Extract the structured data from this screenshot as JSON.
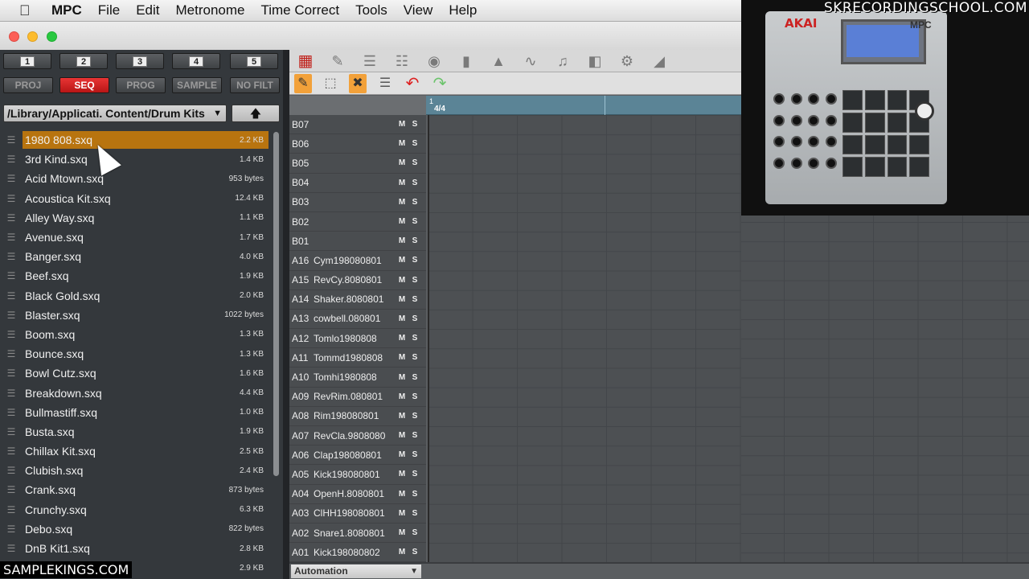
{
  "menubar": {
    "apple": "",
    "app": "MPC",
    "items": [
      "File",
      "Edit",
      "Metronome",
      "Time Correct",
      "Tools",
      "View",
      "Help"
    ]
  },
  "browser": {
    "num_buttons": [
      "1",
      "2",
      "3",
      "4",
      "5"
    ],
    "mode_buttons": [
      "PROJ",
      "SEQ",
      "PROG",
      "SAMPLE",
      "NO FILT"
    ],
    "active_mode": "SEQ",
    "path": "/Library/Applicati. Content/Drum Kits",
    "up_icon": "up-arrow-icon",
    "files": [
      {
        "name": "1980 808.sxq",
        "size": "2.2 KB",
        "selected": true
      },
      {
        "name": "3rd Kind.sxq",
        "size": "1.4 KB"
      },
      {
        "name": "Acid Mtown.sxq",
        "size": "953 bytes"
      },
      {
        "name": "Acoustica Kit.sxq",
        "size": "12.4 KB"
      },
      {
        "name": "Alley Way.sxq",
        "size": "1.1 KB"
      },
      {
        "name": "Avenue.sxq",
        "size": "1.7 KB"
      },
      {
        "name": "Banger.sxq",
        "size": "4.0 KB"
      },
      {
        "name": "Beef.sxq",
        "size": "1.9 KB"
      },
      {
        "name": "Black Gold.sxq",
        "size": "2.0 KB"
      },
      {
        "name": "Blaster.sxq",
        "size": "1022 bytes"
      },
      {
        "name": "Boom.sxq",
        "size": "1.3 KB"
      },
      {
        "name": "Bounce.sxq",
        "size": "1.3 KB"
      },
      {
        "name": "Bowl Cutz.sxq",
        "size": "1.6 KB"
      },
      {
        "name": "Breakdown.sxq",
        "size": "4.4 KB"
      },
      {
        "name": "Bullmastiff.sxq",
        "size": "1.0 KB"
      },
      {
        "name": "Busta.sxq",
        "size": "1.9 KB"
      },
      {
        "name": "Chillax Kit.sxq",
        "size": "2.5 KB"
      },
      {
        "name": "Clubish.sxq",
        "size": "2.4 KB"
      },
      {
        "name": "Crank.sxq",
        "size": "873 bytes"
      },
      {
        "name": "Crunchy.sxq",
        "size": "6.3 KB"
      },
      {
        "name": "Debo.sxq",
        "size": "822 bytes"
      },
      {
        "name": "DnB Kit1.sxq",
        "size": "2.8 KB"
      },
      {
        "name": "",
        "size": "2.9 KB"
      }
    ]
  },
  "sequencer": {
    "timeline": {
      "bar": "1",
      "time_signature": "4/4"
    },
    "tracks": [
      {
        "id": "B07",
        "name": ""
      },
      {
        "id": "B06",
        "name": ""
      },
      {
        "id": "B05",
        "name": ""
      },
      {
        "id": "B04",
        "name": ""
      },
      {
        "id": "B03",
        "name": ""
      },
      {
        "id": "B02",
        "name": ""
      },
      {
        "id": "B01",
        "name": ""
      },
      {
        "id": "A16",
        "name": "Cym198080801"
      },
      {
        "id": "A15",
        "name": "RevCy.8080801"
      },
      {
        "id": "A14",
        "name": "Shaker.8080801"
      },
      {
        "id": "A13",
        "name": "cowbell.080801"
      },
      {
        "id": "A12",
        "name": "Tomlo1980808"
      },
      {
        "id": "A11",
        "name": "Tommd1980808"
      },
      {
        "id": "A10",
        "name": "Tomhi1980808"
      },
      {
        "id": "A09",
        "name": "RevRim.080801"
      },
      {
        "id": "A08",
        "name": "Rim198080801"
      },
      {
        "id": "A07",
        "name": "RevCla.9808080"
      },
      {
        "id": "A06",
        "name": "Clap198080801"
      },
      {
        "id": "A05",
        "name": "Kick198080801"
      },
      {
        "id": "A04",
        "name": "OpenH.8080801"
      },
      {
        "id": "A03",
        "name": "ClHH198080801"
      },
      {
        "id": "A02",
        "name": "Snare1.8080801"
      },
      {
        "id": "A01",
        "name": "Kick198080802"
      }
    ],
    "mute_label": "M",
    "solo_label": "S",
    "automation_label": "Automation"
  },
  "watermarks": {
    "top": "SKRECORDINGSCHOOL.COM",
    "bottom": "SAMPLEKINGS.COM"
  },
  "hardware": {
    "brand": "AKAI",
    "model": "MPC"
  },
  "colors": {
    "selected_row": "#b8740f",
    "active_mode": "#d42020",
    "timeline": "#5b8496"
  }
}
